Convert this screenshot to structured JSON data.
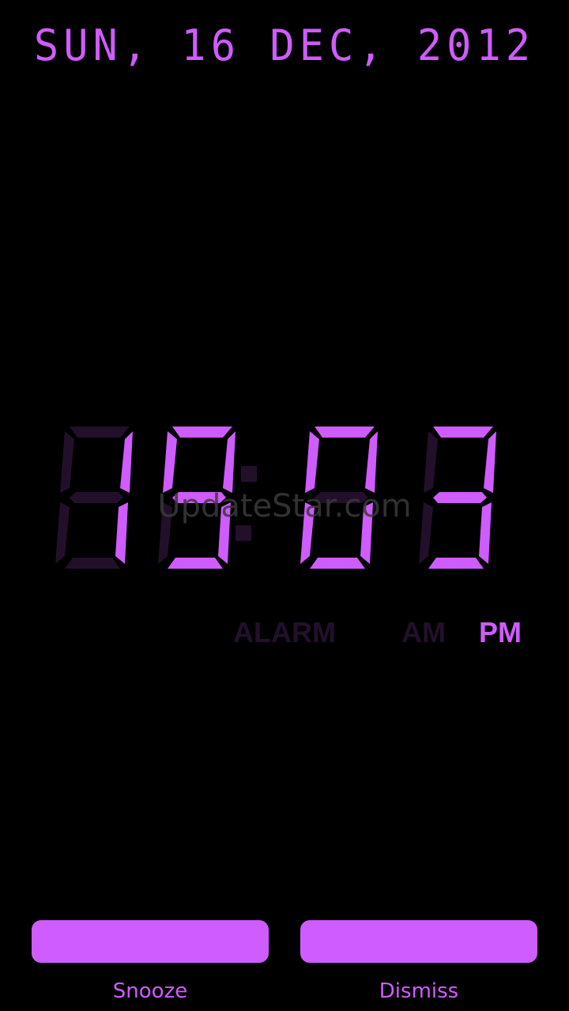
{
  "date": "SUN, 16 DEC, 2012",
  "clock": {
    "time": "19:03",
    "digits": [
      "1",
      "9",
      "0",
      "3"
    ],
    "colors": {
      "on": "#cf5cff",
      "off": "#22102b"
    }
  },
  "watermark": "UpdateStar.com",
  "indicators": {
    "alarm": "ALARM",
    "am": "AM",
    "pm": "PM",
    "active": "pm"
  },
  "buttons": {
    "snooze": "Snooze",
    "dismiss": "Dismiss"
  }
}
